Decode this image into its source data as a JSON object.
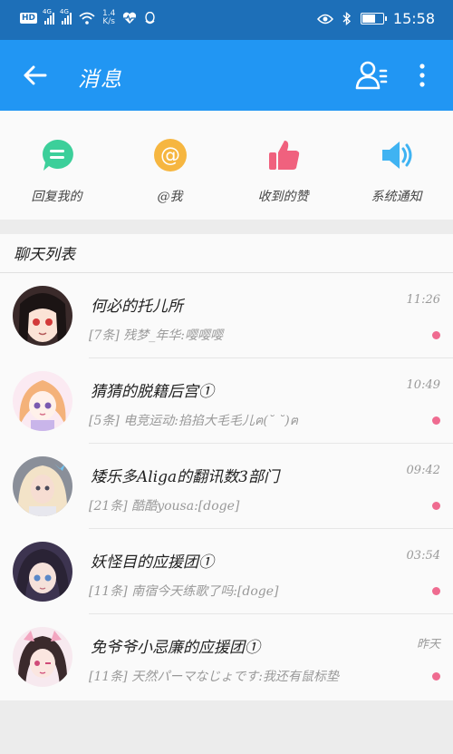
{
  "status_bar": {
    "hd": "HD",
    "net1": "4G",
    "net2": "4G",
    "speed_value": "1.4",
    "speed_unit": "K/s",
    "time": "15:58"
  },
  "header": {
    "title": "消息"
  },
  "quick_actions": [
    {
      "label": "回复我的",
      "icon": "chat-bubble-icon",
      "color": "#3ccf9a"
    },
    {
      "label": "@我",
      "icon": "at-sign-icon",
      "color": "#f6b640"
    },
    {
      "label": "收到的赞",
      "icon": "thumbs-up-icon",
      "color": "#f0617e"
    },
    {
      "label": "系统通知",
      "icon": "speaker-icon",
      "color": "#3fb3f2"
    }
  ],
  "chat_list": {
    "title": "聊天列表",
    "items": [
      {
        "name": "何必的托儿所",
        "preview": "[7条] 残梦_年华:嘤嘤嘤",
        "time": "11:26",
        "unread": true
      },
      {
        "name": "猜猜的脱籍后宫①",
        "preview": "[5条] 电竞运动:掐掐大毛毛儿ฅ(˘ ˘)ฅ",
        "time": "10:49",
        "unread": true
      },
      {
        "name": "矮乐多Aliga的翻讯数3部门",
        "preview": "[21条] 酷酷yousa:[doge]",
        "time": "09:42",
        "unread": true
      },
      {
        "name": "妖怪目的应援团①",
        "preview": "[11条] 南宿今天练歌了吗:[doge]",
        "time": "03:54",
        "unread": true
      },
      {
        "name": "免爷爷小忌廉的应援团①",
        "preview": "[11条] 天然パーマなじょです:我还有鼠标垫",
        "time": "昨天",
        "unread": true
      }
    ]
  }
}
